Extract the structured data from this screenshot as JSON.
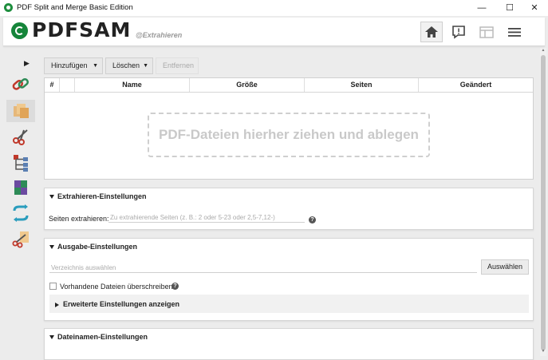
{
  "window": {
    "title": "PDF Split and Merge Basic Edition",
    "controls": {
      "minimize": "—",
      "maximize": "☐",
      "close": "✕"
    }
  },
  "header": {
    "logo": "PDFSAM",
    "module": "@Extrahieren",
    "buttons": [
      "home-icon",
      "news-icon",
      "layout-icon",
      "menu-icon"
    ]
  },
  "sidebar": {
    "expand": "▶",
    "items": [
      {
        "name": "merge-module",
        "icon": "chain-icon",
        "color": "#c0392b"
      },
      {
        "name": "extract-module",
        "icon": "pages-icon",
        "color": "#e0a458",
        "active": true
      },
      {
        "name": "split-module",
        "icon": "scissors-icon",
        "color": "#c0392b"
      },
      {
        "name": "split-bookmarks-module",
        "icon": "tree-icon",
        "color": "#5b7fb3"
      },
      {
        "name": "alternate-mix-module",
        "icon": "mix-icon",
        "color": "#2e8b57"
      },
      {
        "name": "rotate-module",
        "icon": "rotate-icon",
        "color": "#2a9dbd"
      },
      {
        "name": "split-size-module",
        "icon": "scissors-pages-icon",
        "color": "#d98c3a"
      }
    ]
  },
  "toolbar": {
    "add": "Hinzufügen",
    "delete": "Löschen",
    "remove": "Entfernen"
  },
  "table": {
    "columns": [
      "#",
      "",
      "Name",
      "Größe",
      "Seiten",
      "Geändert"
    ],
    "drop_text": "PDF-Dateien hierher ziehen und ablegen"
  },
  "extract": {
    "title": "Extrahieren-Einstellungen",
    "pages_label": "Seiten extrahieren:",
    "pages_placeholder": "Zu extrahierende Seiten (z. B.: 2 oder 5-23 oder 2,5-7,12-)",
    "pages_value": ""
  },
  "output": {
    "title": "Ausgabe-Einstellungen",
    "dir_placeholder": "Verzeichnis auswählen",
    "choose": "Auswählen",
    "overwrite_label": "Vorhandene Dateien überschreiben",
    "overwrite_checked": false,
    "advanced": "Erweiterte Einstellungen anzeigen"
  },
  "filename": {
    "title": "Dateinamen-Einstellungen"
  },
  "colors": {
    "accent": "#15853a",
    "background": "#ececec"
  }
}
